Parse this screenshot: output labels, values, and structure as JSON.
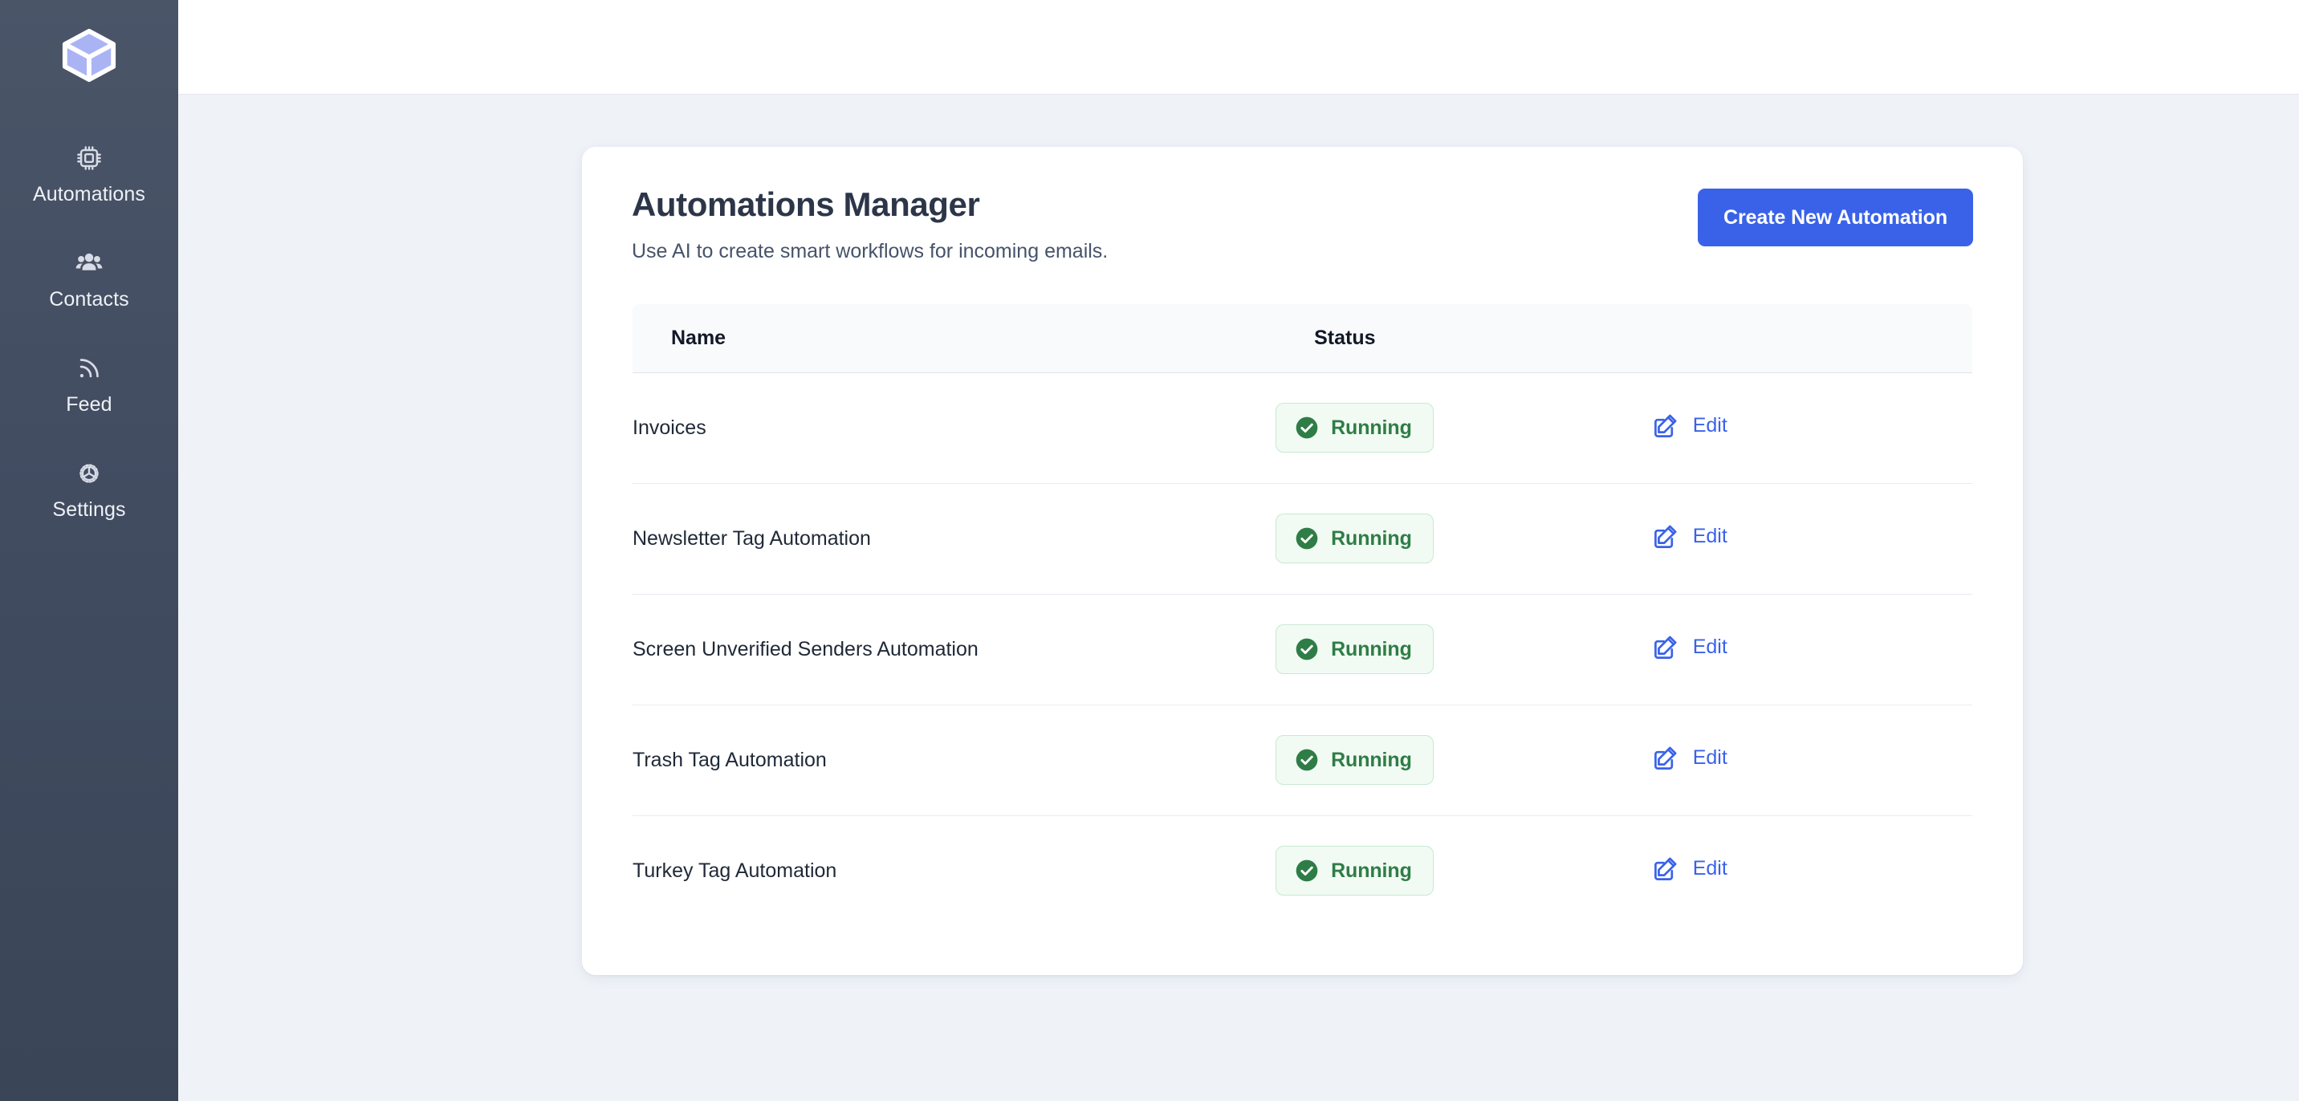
{
  "app": {
    "logo_icon": "cube-logo-icon",
    "accent_blue": "#3a62e8",
    "sidebar_bg_top": "#4b5568",
    "sidebar_bg_bottom": "#3a4557",
    "page_bg": "#eff3f8",
    "status_green": "#2f7d46",
    "status_green_bg": "#f1fbf3"
  },
  "sidebar": {
    "items": [
      {
        "label": "Automations",
        "icon": "cpu-chip-icon"
      },
      {
        "label": "Contacts",
        "icon": "users-group-icon"
      },
      {
        "label": "Feed",
        "icon": "rss-feed-icon"
      },
      {
        "label": "Settings",
        "icon": "gear-icon"
      }
    ]
  },
  "main": {
    "title": "Automations Manager",
    "subtitle": "Use AI to create smart workflows for incoming emails.",
    "create_button_label": "Create New Automation",
    "table": {
      "columns": [
        "Name",
        "Status",
        ""
      ],
      "rows": [
        {
          "name": "Invoices",
          "status": "Running",
          "status_icon": "check-circle-icon",
          "action": "Edit",
          "action_icon": "edit-square-icon"
        },
        {
          "name": "Newsletter Tag Automation",
          "status": "Running",
          "status_icon": "check-circle-icon",
          "action": "Edit",
          "action_icon": "edit-square-icon"
        },
        {
          "name": "Screen Unverified Senders Automation",
          "status": "Running",
          "status_icon": "check-circle-icon",
          "action": "Edit",
          "action_icon": "edit-square-icon"
        },
        {
          "name": "Trash Tag Automation",
          "status": "Running",
          "status_icon": "check-circle-icon",
          "action": "Edit",
          "action_icon": "edit-square-icon"
        },
        {
          "name": "Turkey Tag Automation",
          "status": "Running",
          "status_icon": "check-circle-icon",
          "action": "Edit",
          "action_icon": "edit-square-icon"
        }
      ]
    }
  }
}
